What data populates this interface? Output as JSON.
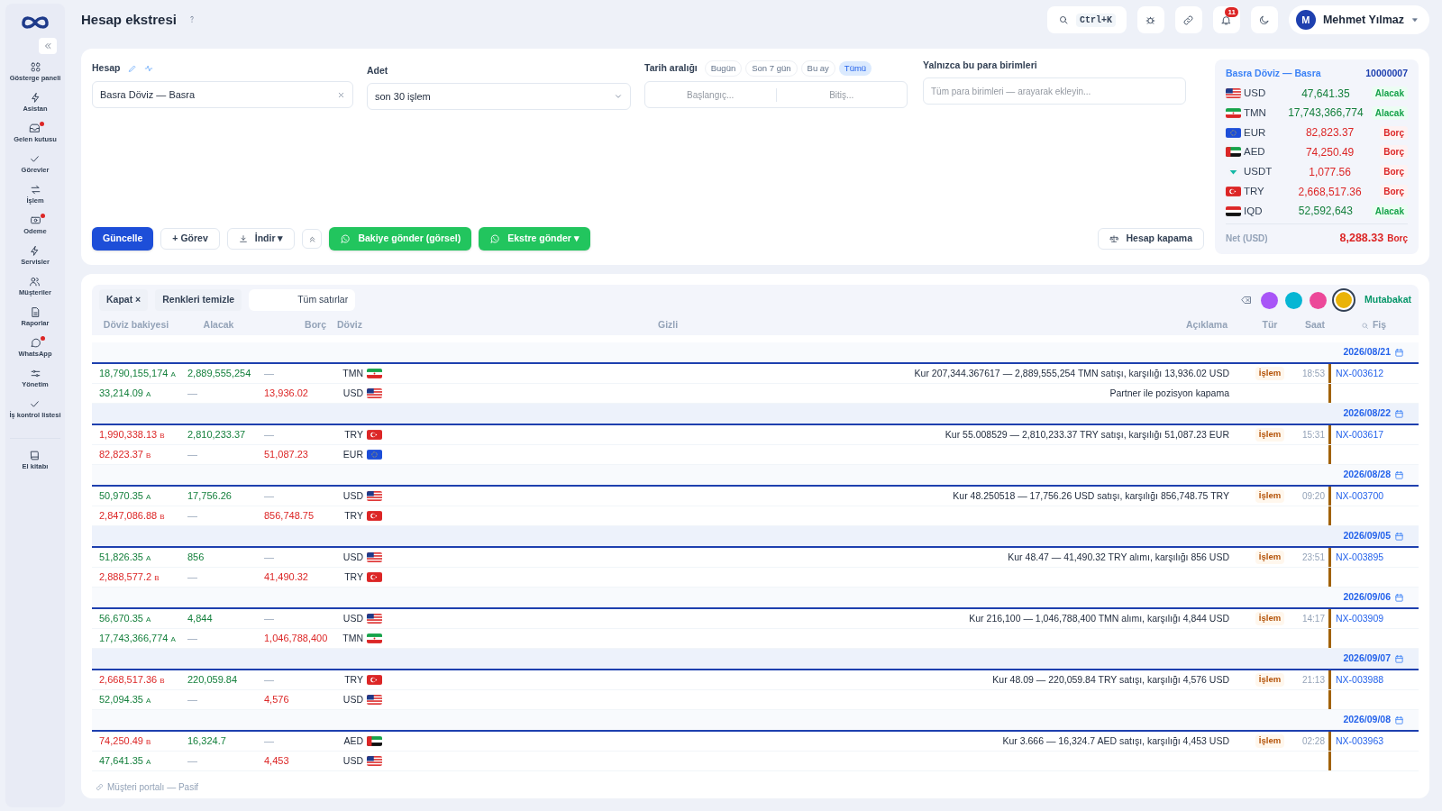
{
  "sidebar": {
    "items": [
      {
        "label": "Gösterge paneli",
        "dot": false
      },
      {
        "label": "Asistan",
        "dot": false
      },
      {
        "label": "Gelen kutusu",
        "dot": true
      },
      {
        "label": "Görevler",
        "dot": false
      },
      {
        "label": "İşlem",
        "dot": false
      },
      {
        "label": "Odeme",
        "dot": true
      },
      {
        "label": "Servisler",
        "dot": false
      },
      {
        "label": "Müşteriler",
        "dot": false
      },
      {
        "label": "Raporlar",
        "dot": false
      },
      {
        "label": "WhatsApp",
        "dot": true
      },
      {
        "label": "Yönetim",
        "dot": false
      },
      {
        "label": "İş kontrol listesi",
        "dot": false
      },
      {
        "label": "El kitabı",
        "dot": false
      }
    ]
  },
  "header": {
    "title": "Hesap ekstresi",
    "search_shortcut": "Ctrl+K",
    "notifications": "11",
    "user_initial": "M",
    "user_name": "Mehmet Yılmaz"
  },
  "filters": {
    "account_label": "Hesap",
    "account_value": "Basra Döviz — Basra",
    "count_label": "Adet",
    "count_value": "son 30 işlem",
    "date_label": "Tarih aralığı",
    "date_presets": [
      {
        "label": "Bugün",
        "selected": false
      },
      {
        "label": "Son 7 gün",
        "selected": false
      },
      {
        "label": "Bu ay",
        "selected": false
      },
      {
        "label": "Tümü",
        "selected": true
      }
    ],
    "start_placeholder": "Başlangıç...",
    "end_placeholder": "Bitiş...",
    "currency_label": "Yalnızca bu para birimleri",
    "currency_placeholder": "Tüm para birimleri — arayarak ekleyin..."
  },
  "actions": {
    "refresh": "Güncelle",
    "task": "+ Görev",
    "download": "İndir ▾",
    "send_balance": "Bakiye gönder (görsel)",
    "send_statement": "Ekstre gönder ▾",
    "close_account": "Hesap kapama"
  },
  "summary": {
    "account": "Basra Döviz — Basra",
    "number": "10000007",
    "rows": [
      {
        "kind": "us",
        "code": "USD",
        "amount": "47,641.35",
        "side": "Alacak",
        "credit": true
      },
      {
        "kind": "ir",
        "code": "TMN",
        "amount": "17,743,366,774",
        "side": "Alacak",
        "credit": true
      },
      {
        "kind": "eu",
        "code": "EUR",
        "amount": "82,823.37",
        "side": "Borç",
        "credit": false
      },
      {
        "kind": "ae",
        "code": "AED",
        "amount": "74,250.49",
        "side": "Borç",
        "credit": false
      },
      {
        "kind": "tether",
        "code": "USDT",
        "amount": "1,077.56",
        "side": "Borç",
        "credit": false
      },
      {
        "kind": "tr",
        "code": "TRY",
        "amount": "2,668,517.36",
        "side": "Borç",
        "credit": false
      },
      {
        "kind": "iq",
        "code": "IQD",
        "amount": "52,592,643",
        "side": "Alacak",
        "credit": true
      }
    ],
    "net_label": "Net (USD)",
    "net_amount": "8,288.33",
    "net_side": "Borç",
    "net_credit": false
  },
  "toolbar": {
    "close": "Kapat ×",
    "clear_colors": "Renkleri temizle",
    "filter": "Tüm satırlar",
    "swatches": [
      {
        "color": "#a855f7",
        "selected": false
      },
      {
        "color": "#06b6d4",
        "selected": false
      },
      {
        "color": "#ec4899",
        "selected": false
      },
      {
        "color": "#eab308",
        "selected": true
      }
    ],
    "reconcile": "Mutabakat"
  },
  "table": {
    "columns": [
      "Döviz bakiyesi",
      "Alacak",
      "Borç",
      "Döviz",
      "Gizli",
      "Açıklama",
      "Tür",
      "Saat",
      "Fiş"
    ],
    "groups": [
      {
        "date": "2026/08/21",
        "rows": [
          {
            "balance": "18,790,155,174",
            "side": "A",
            "credit": true,
            "credit_amount": "2,889,555,254",
            "debit_amount": "—",
            "currency": "TMN",
            "kind": "ir",
            "description": "Kur 207,344.367617 — 2,889,555,254 TMN satışı, karşılığı 13,936.02 USD",
            "type": "İşlem",
            "time": "18:53",
            "receipt": "NX-003612"
          },
          {
            "balance": "33,214.09",
            "side": "A",
            "credit": true,
            "credit_amount": "—",
            "debit_amount": "13,936.02",
            "currency": "USD",
            "kind": "us",
            "description": "Partner ile pozisyon kapama"
          }
        ]
      },
      {
        "date": "2026/08/22",
        "rows": [
          {
            "balance": "1,990,338.13",
            "side": "B",
            "credit": false,
            "credit_amount": "2,810,233.37",
            "debit_amount": "—",
            "currency": "TRY",
            "kind": "tr",
            "description": "Kur 55.008529 — 2,810,233.37 TRY satışı, karşılığı 51,087.23 EUR",
            "type": "İşlem",
            "time": "15:31",
            "receipt": "NX-003617"
          },
          {
            "balance": "82,823.37",
            "side": "B",
            "credit": false,
            "credit_amount": "—",
            "debit_amount": "51,087.23",
            "currency": "EUR",
            "kind": "eu"
          }
        ]
      },
      {
        "date": "2026/08/28",
        "rows": [
          {
            "balance": "50,970.35",
            "side": "A",
            "credit": true,
            "credit_amount": "17,756.26",
            "debit_amount": "—",
            "currency": "USD",
            "kind": "us",
            "description": "Kur 48.250518 — 17,756.26 USD satışı, karşılığı 856,748.75 TRY",
            "type": "İşlem",
            "time": "09:20",
            "receipt": "NX-003700"
          },
          {
            "balance": "2,847,086.88",
            "side": "B",
            "credit": false,
            "credit_amount": "—",
            "debit_amount": "856,748.75",
            "currency": "TRY",
            "kind": "tr"
          }
        ]
      },
      {
        "date": "2026/09/05",
        "rows": [
          {
            "balance": "51,826.35",
            "side": "A",
            "credit": true,
            "credit_amount": "856",
            "debit_amount": "—",
            "currency": "USD",
            "kind": "us",
            "description": "Kur 48.47 — 41,490.32 TRY alımı, karşılığı 856 USD",
            "type": "İşlem",
            "time": "23:51",
            "receipt": "NX-003895"
          },
          {
            "balance": "2,888,577.2",
            "side": "B",
            "credit": false,
            "credit_amount": "—",
            "debit_amount": "41,490.32",
            "currency": "TRY",
            "kind": "tr"
          }
        ]
      },
      {
        "date": "2026/09/06",
        "rows": [
          {
            "balance": "56,670.35",
            "side": "A",
            "credit": true,
            "credit_amount": "4,844",
            "debit_amount": "—",
            "currency": "USD",
            "kind": "us",
            "description": "Kur 216,100 — 1,046,788,400 TMN alımı, karşılığı 4,844 USD",
            "type": "İşlem",
            "time": "14:17",
            "receipt": "NX-003909"
          },
          {
            "balance": "17,743,366,774",
            "side": "A",
            "credit": true,
            "credit_amount": "—",
            "debit_amount": "1,046,788,400",
            "currency": "TMN",
            "kind": "ir"
          }
        ]
      },
      {
        "date": "2026/09/07",
        "rows": [
          {
            "balance": "2,668,517.36",
            "side": "B",
            "credit": false,
            "credit_amount": "220,059.84",
            "debit_amount": "—",
            "currency": "TRY",
            "kind": "tr",
            "description": "Kur 48.09 — 220,059.84 TRY satışı, karşılığı 4,576 USD",
            "type": "İşlem",
            "time": "21:13",
            "receipt": "NX-003988"
          },
          {
            "balance": "52,094.35",
            "side": "A",
            "credit": true,
            "credit_amount": "—",
            "debit_amount": "4,576",
            "currency": "USD",
            "kind": "us"
          }
        ]
      },
      {
        "date": "2026/09/08",
        "rows": [
          {
            "balance": "74,250.49",
            "side": "B",
            "credit": false,
            "credit_amount": "16,324.7",
            "debit_amount": "—",
            "currency": "AED",
            "kind": "ae",
            "description": "Kur 3.666 — 16,324.7 AED satışı, karşılığı 4,453 USD",
            "type": "İşlem",
            "time": "02:28",
            "receipt": "NX-003963"
          },
          {
            "balance": "47,641.35",
            "side": "A",
            "credit": true,
            "credit_amount": "—",
            "debit_amount": "4,453",
            "currency": "USD",
            "kind": "us"
          }
        ]
      }
    ]
  },
  "footer": {
    "portal": "Müşteri portalı — Pasif"
  }
}
